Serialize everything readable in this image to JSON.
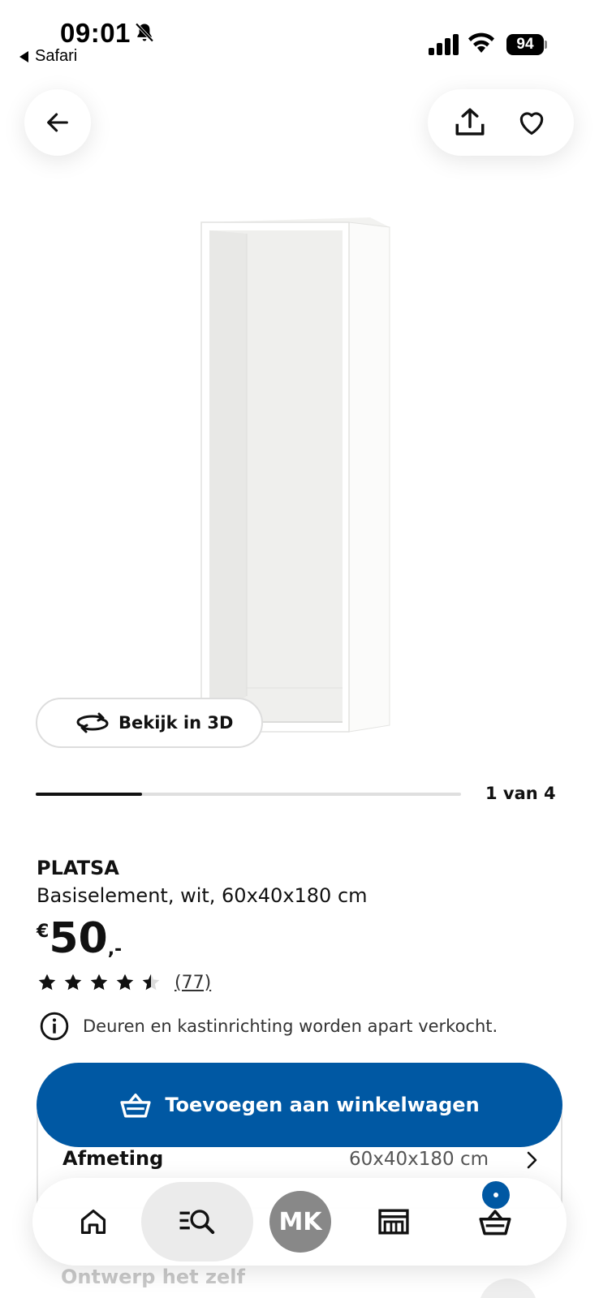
{
  "status_bar": {
    "time": "09:01",
    "back_app": "Safari",
    "battery": "94"
  },
  "icons": {
    "back": "arrow-left-icon",
    "share": "share-icon",
    "favorite": "heart-icon",
    "rotate3d": "rotate-3d-icon",
    "info": "info-icon",
    "basket": "basket-icon",
    "home": "home-icon",
    "search": "search-list-icon",
    "store": "store-icon",
    "cart": "cart-icon"
  },
  "carousel": {
    "view3d_label": "Bekijk in 3D",
    "page_label": "1 van 4",
    "current": 1,
    "total": 4
  },
  "product": {
    "brand": "PLATSA",
    "description": "Basiselement, wit, 60x40x180 cm",
    "price": {
      "currency": "€",
      "amount": "50",
      "decimals": ",-"
    },
    "rating": {
      "stars": 4.5,
      "max": 5,
      "review_count": "(77)"
    },
    "notice": "Deuren en kastinrichting worden apart verkocht."
  },
  "actions": {
    "add_to_cart": "Toevoegen aan winkelwagen"
  },
  "details": {
    "dimension_label": "Afmeting",
    "dimension_value": "60x40x180 cm",
    "design_label": "Ontwerp het zelf"
  },
  "tab_bar": {
    "profile_initials": "MK",
    "active_tab": "search"
  },
  "colors": {
    "accent": "#0058a3",
    "avatar": "#888888"
  }
}
